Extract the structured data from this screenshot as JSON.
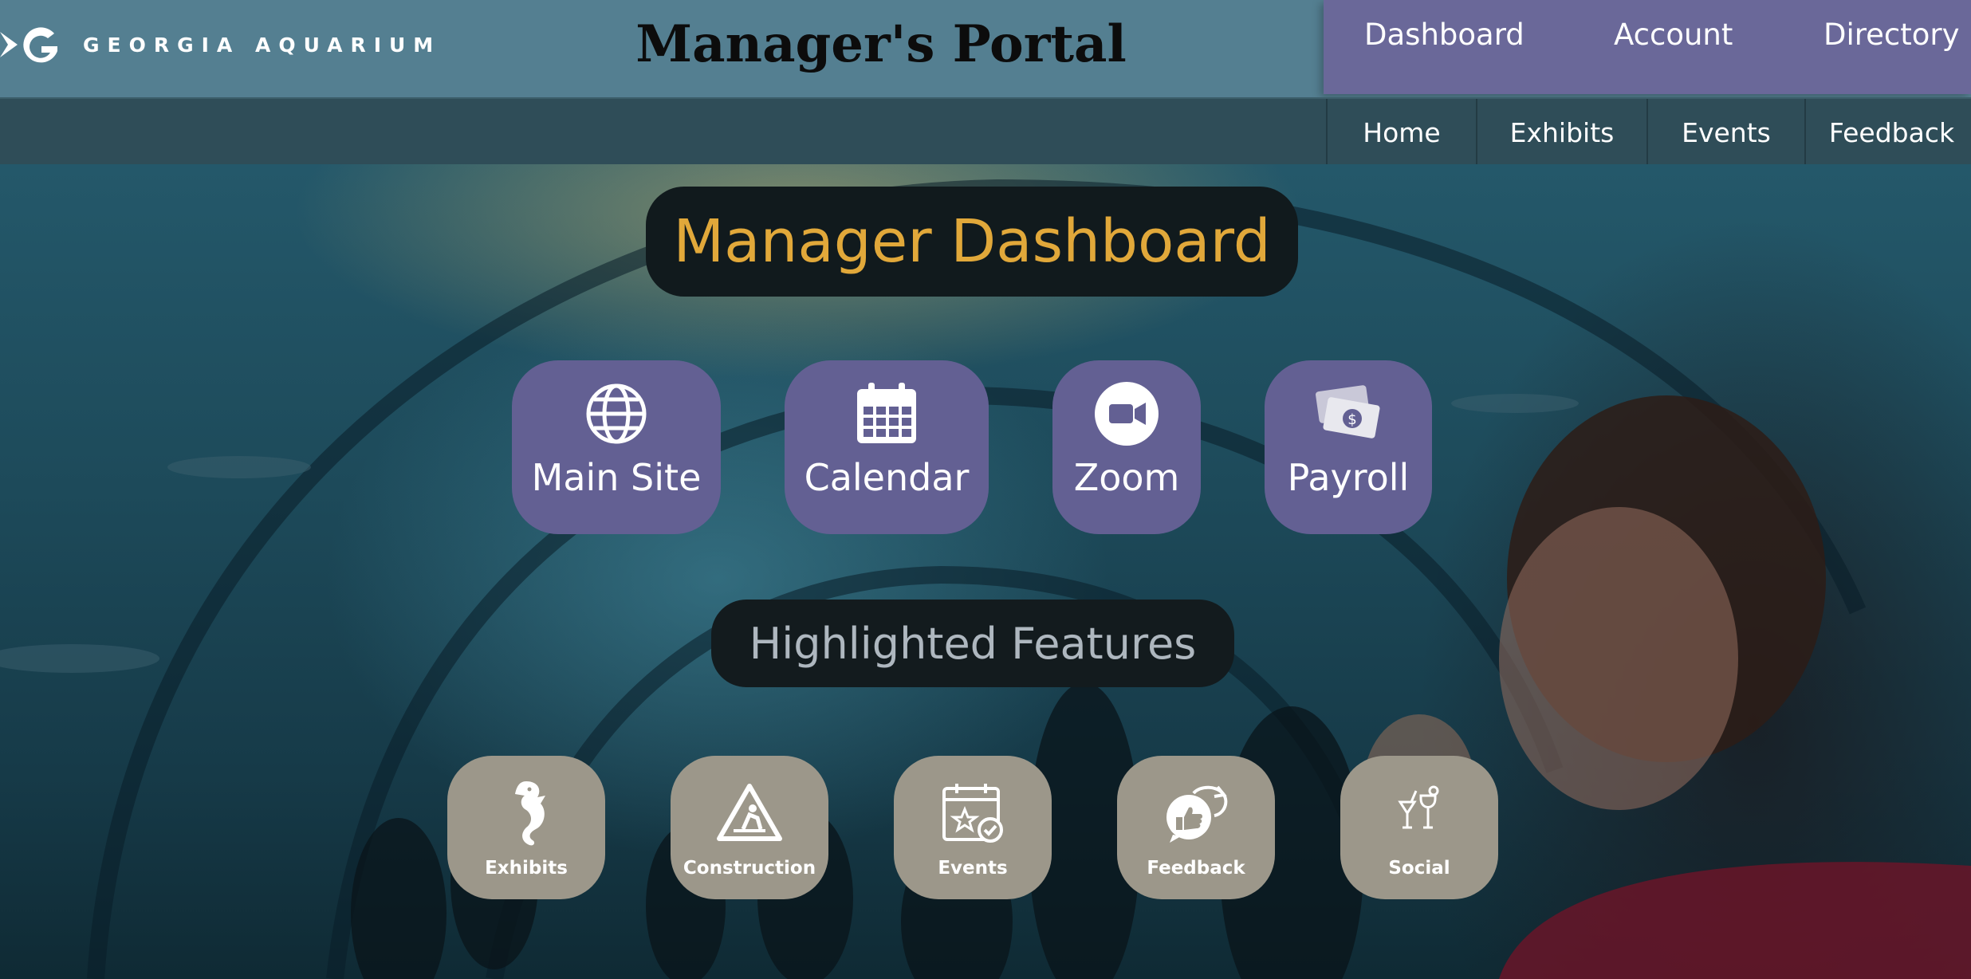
{
  "brand": {
    "logo_text": "GEORGIA AQUARIUM",
    "page_title": "Manager's Portal"
  },
  "primary_nav": [
    {
      "label": "Dashboard"
    },
    {
      "label": "Account"
    },
    {
      "label": "Directory"
    }
  ],
  "secondary_nav": [
    {
      "label": "Home"
    },
    {
      "label": "Exhibits"
    },
    {
      "label": "Events"
    },
    {
      "label": "Feedback"
    }
  ],
  "dashboard": {
    "title": "Manager Dashboard",
    "tiles": [
      {
        "label": "Main Site",
        "icon": "globe-icon"
      },
      {
        "label": "Calendar",
        "icon": "calendar-icon"
      },
      {
        "label": "Zoom",
        "icon": "video-camera-icon"
      },
      {
        "label": "Payroll",
        "icon": "money-icon"
      }
    ]
  },
  "features": {
    "title": "Highlighted Features",
    "tiles": [
      {
        "label": "Exhibits",
        "icon": "seahorse-icon"
      },
      {
        "label": "Construction",
        "icon": "construction-sign-icon"
      },
      {
        "label": "Events",
        "icon": "event-calendar-icon"
      },
      {
        "label": "Feedback",
        "icon": "feedback-chat-icon"
      },
      {
        "label": "Social",
        "icon": "cocktail-glasses-icon"
      }
    ]
  },
  "colors": {
    "header_bg": "#547f91",
    "nav_bg": "#6a6899",
    "subbar_bg": "#2f4d58",
    "dashboard_tile": "#636093",
    "feature_tile": "#9c978a",
    "dashboard_title": "#e1a83a"
  }
}
